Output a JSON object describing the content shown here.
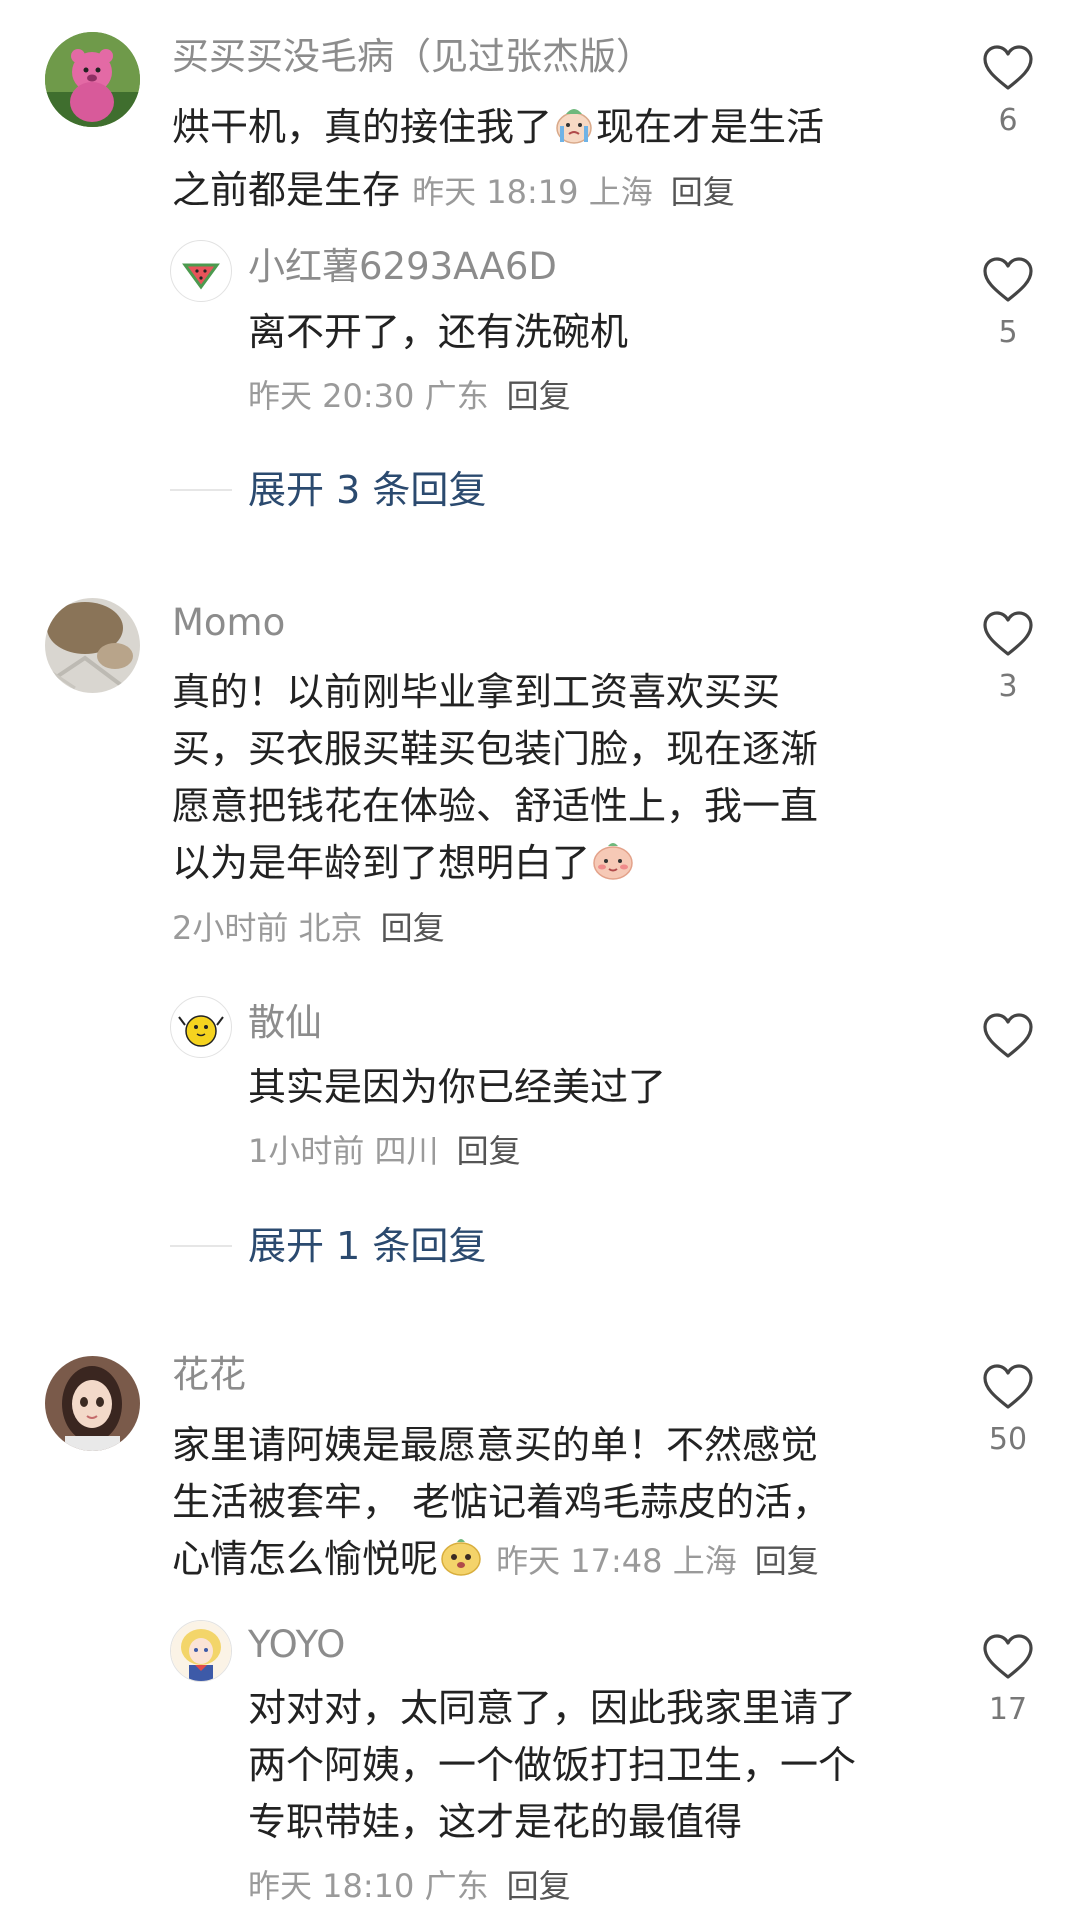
{
  "comments": [
    {
      "name": "买买买没毛病（见过张杰版）",
      "lines": [
        "烘干机，真的接住我了",
        "现在才是生活",
        "之前都是生存"
      ],
      "meta": {
        "time": "昨天 18:19",
        "location": "上海",
        "reply": "回复"
      },
      "likes": "6",
      "avatar": "pink-bear-avatar",
      "replies": [
        {
          "name": "小红薯6293AA6D",
          "lines": [
            "离不开了，还有洗碗机"
          ],
          "meta": {
            "time": "昨天 20:30",
            "location": "广东",
            "reply": "回复"
          },
          "likes": "5",
          "avatar": "watermelon-avatar"
        }
      ],
      "expand": "展开 3 条回复"
    },
    {
      "name": "Momo",
      "lines": [
        "真的！以前刚毕业拿到工资喜欢买买",
        "买，买衣服买鞋买包装门脸，现在逐渐",
        "愿意把钱花在体验、舒适性上，我一直",
        "以为是年龄到了想明白了"
      ],
      "meta": {
        "time": "2小时前",
        "location": "北京",
        "reply": "回复"
      },
      "likes": "3",
      "avatar": "cat-avatar",
      "replies": [
        {
          "name": "散仙",
          "lines": [
            "其实是因为你已经美过了"
          ],
          "meta": {
            "time": "1小时前",
            "location": "四川",
            "reply": "回复"
          },
          "likes": "",
          "avatar": "yellow-duck-avatar"
        }
      ],
      "expand": "展开 1 条回复"
    },
    {
      "name": "花花",
      "lines": [
        "家里请阿姨是最愿意买的单！不然感觉",
        "生活被套牢， 老惦记着鸡毛蒜皮的活，",
        "心情怎么愉悦呢"
      ],
      "meta": {
        "time": "昨天 17:48",
        "location": "上海",
        "reply": "回复"
      },
      "likes": "50",
      "avatar": "girl-avatar",
      "replies": [
        {
          "name": "YOYO",
          "lines": [
            "对对对，太同意了，因此我家里请了",
            "两个阿姨，一个做饭打扫卫生，一个",
            "专职带娃，这才是花的最值得"
          ],
          "meta": {
            "time": "昨天 18:10",
            "location": "广东",
            "reply": "回复"
          },
          "likes": "17",
          "avatar": "anime-avatar"
        }
      ]
    }
  ],
  "icons": {
    "like": "heart-outline-icon"
  },
  "colors": {
    "name": "#8c8c8c",
    "text": "#222222",
    "meta": "#9a9a9a",
    "expand": "#2b4a6f"
  }
}
